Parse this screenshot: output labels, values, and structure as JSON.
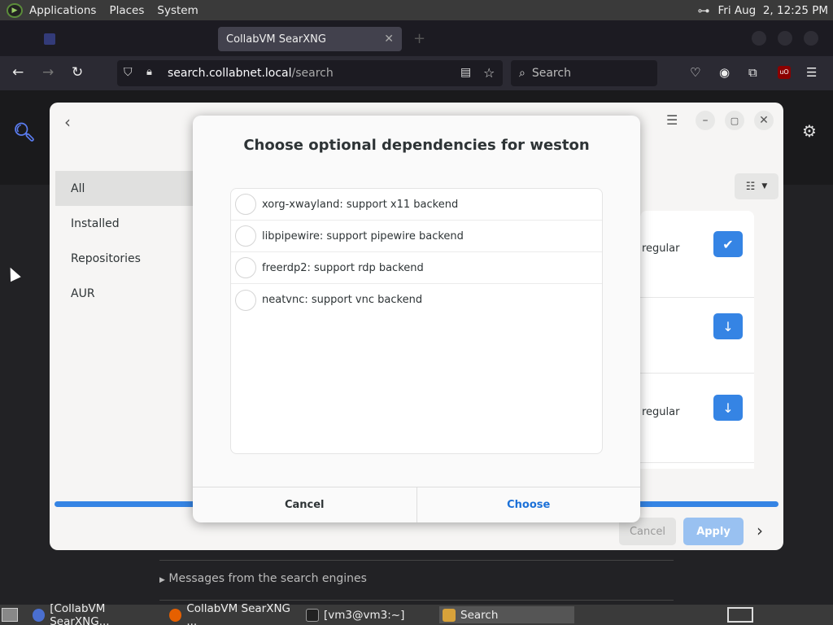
{
  "top_panel": {
    "menus": [
      "Applications",
      "Places",
      "System"
    ],
    "clock": "Fri Aug  2, 12:25 PM"
  },
  "browser": {
    "tabs": [
      {
        "label": "",
        "active": false
      },
      {
        "label": "CollabVM SearXNG",
        "active": true
      }
    ],
    "url_domain": "search.collabnet.local",
    "url_path": "/search",
    "search_placeholder": "Search",
    "ublock_badge": "uO"
  },
  "webpage": {
    "search_engine_messages": "Messages from the search engines"
  },
  "pamac": {
    "sidebar": [
      {
        "label": "All",
        "selected": true
      },
      {
        "label": "Installed",
        "selected": false
      },
      {
        "label": "Repositories",
        "selected": false
      },
      {
        "label": "AUR",
        "selected": false
      }
    ],
    "rows": [
      {
        "text": "regular",
        "action": "check"
      },
      {
        "text": "",
        "action": "install"
      },
      {
        "text": "regular",
        "action": "install"
      }
    ],
    "cancel_label": "Cancel",
    "apply_label": "Apply",
    "accent_color": "#3584e4"
  },
  "dialog": {
    "title": "Choose optional dependencies for weston",
    "options": [
      {
        "label": "xorg-xwayland: support x11 backend",
        "checked": false
      },
      {
        "label": "libpipewire: support pipewire backend",
        "checked": false
      },
      {
        "label": "freerdp2: support rdp backend",
        "checked": false
      },
      {
        "label": "neatvnc: support vnc backend",
        "checked": false
      }
    ],
    "cancel_label": "Cancel",
    "choose_label": "Choose"
  },
  "taskbar": {
    "items": [
      {
        "label": "[CollabVM SearXNG...",
        "active": false
      },
      {
        "label": "CollabVM SearXNG ...",
        "active": false
      },
      {
        "label": "[vm3@vm3:~]",
        "active": false
      },
      {
        "label": "Search",
        "active": true
      }
    ]
  }
}
